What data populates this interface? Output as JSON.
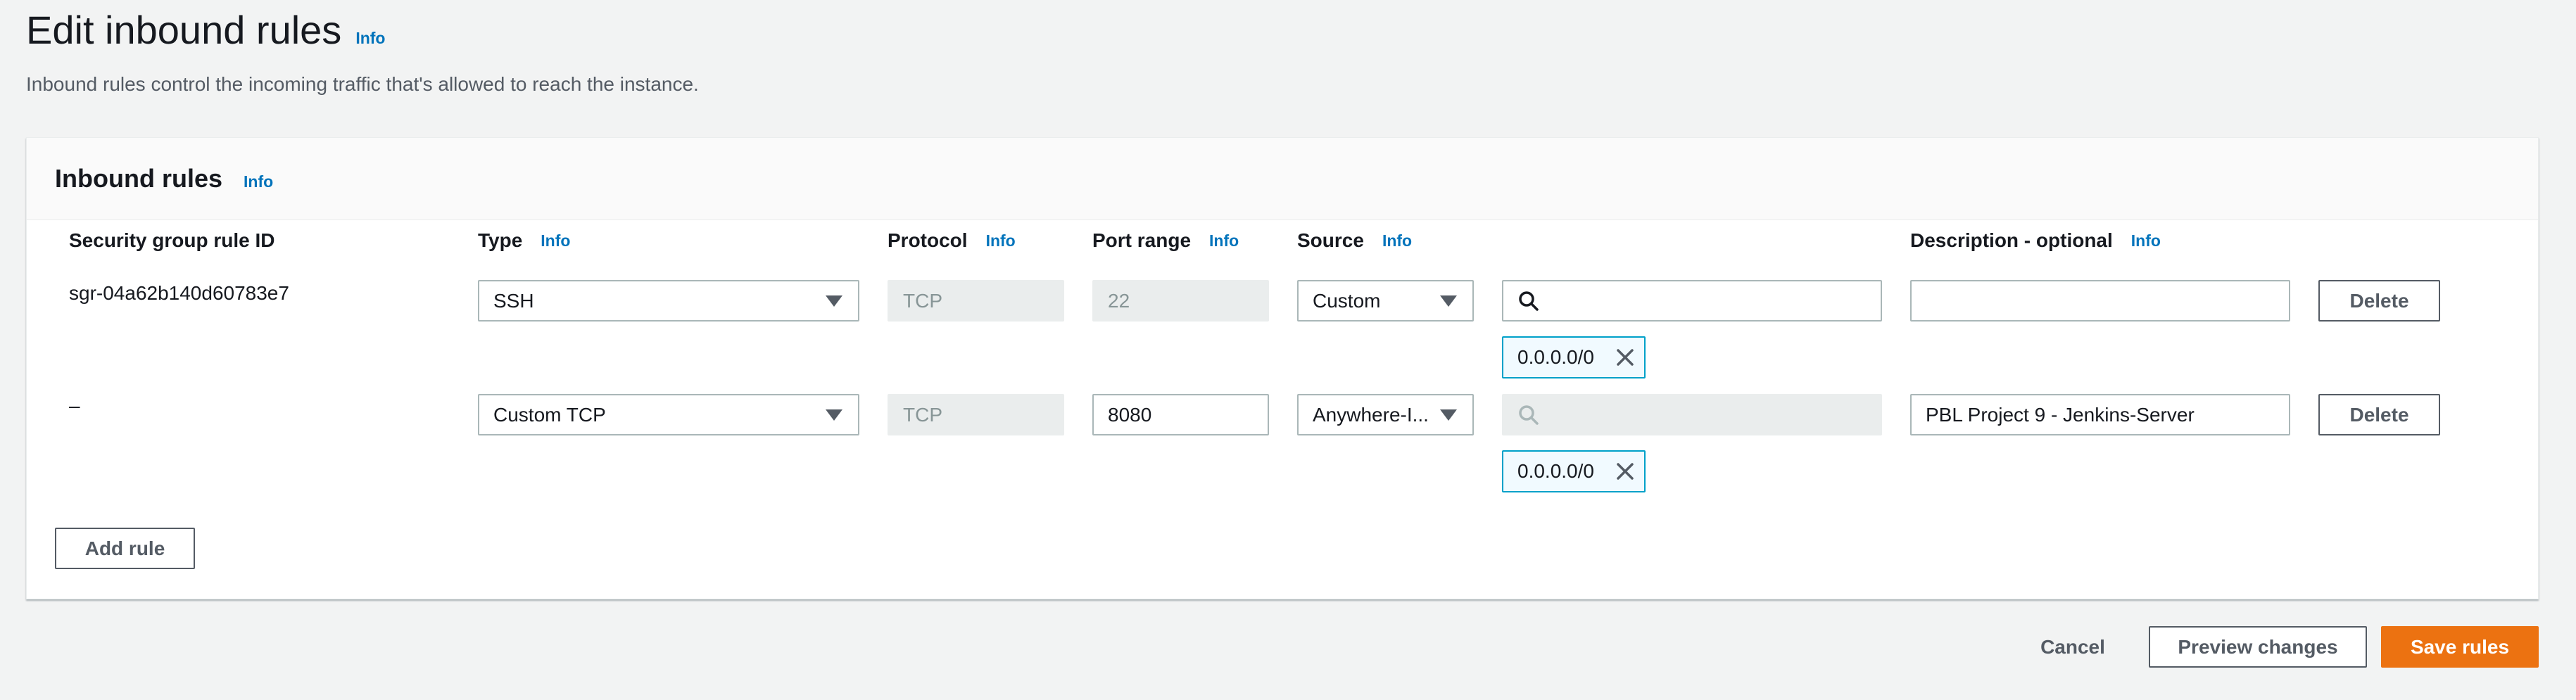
{
  "page": {
    "title": "Edit inbound rules",
    "title_info": "Info",
    "description": "Inbound rules control the incoming traffic that's allowed to reach the instance."
  },
  "panel": {
    "title": "Inbound rules",
    "title_info": "Info",
    "columns": {
      "rule_id": "Security group rule ID",
      "type": "Type",
      "type_info": "Info",
      "protocol": "Protocol",
      "protocol_info": "Info",
      "port_range": "Port range",
      "port_range_info": "Info",
      "source": "Source",
      "source_info": "Info",
      "description": "Description - optional",
      "description_info": "Info"
    },
    "rules": [
      {
        "rule_id": "sgr-04a62b140d60783e7",
        "type": "SSH",
        "protocol": "TCP",
        "port_range": "22",
        "source": "Custom",
        "search_value": "",
        "cidr_token": "0.0.0.0/0",
        "description": "",
        "delete_label": "Delete"
      },
      {
        "rule_id": "–",
        "type": "Custom TCP",
        "protocol": "TCP",
        "port_range": "8080",
        "source": "Anywhere-I...",
        "search_value": "",
        "cidr_token": "0.0.0.0/0",
        "description": "PBL Project 9 - Jenkins-Server",
        "delete_label": "Delete"
      }
    ],
    "add_rule_label": "Add rule"
  },
  "footer": {
    "cancel_label": "Cancel",
    "preview_label": "Preview changes",
    "save_label": "Save rules"
  },
  "icons": {
    "search": "search-icon",
    "close": "close-icon",
    "dropdown": "caret-down-icon"
  },
  "colors": {
    "primary_button": "#ec7211",
    "info_link": "#0073bb",
    "token_border": "#00a1c9"
  }
}
